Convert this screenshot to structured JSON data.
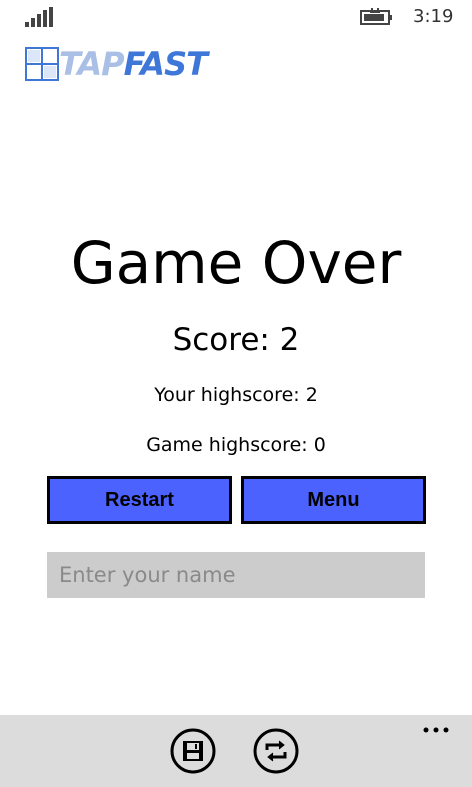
{
  "status_bar": {
    "time": "3:19",
    "signal_icon": "signal-strength-icon",
    "battery_icon": "battery-charging-icon"
  },
  "logo": {
    "text_tap": "TAP",
    "text_fast": "FAST",
    "colors": {
      "tap": "#a9bfe6",
      "fast": "#3f77d8",
      "grid": "#3f77d8"
    }
  },
  "game_over": {
    "title": "Game Over",
    "score": "Score: 2",
    "your_highscore": "Your highscore: 2",
    "game_highscore": "Game highscore: 0"
  },
  "buttons": {
    "restart": "Restart",
    "menu": "Menu",
    "color": "#4b62ff"
  },
  "name_input": {
    "placeholder": "Enter your name",
    "value": ""
  },
  "app_bar": {
    "save_icon": "save-icon",
    "sync_icon": "sync-icon",
    "more_icon": "more-icon"
  }
}
